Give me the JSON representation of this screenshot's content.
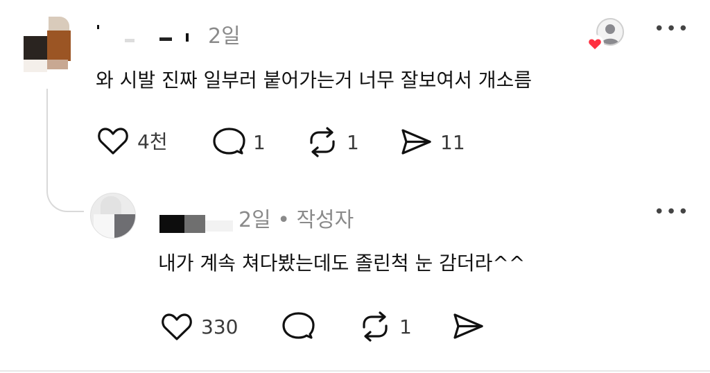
{
  "comment": {
    "time": "2일",
    "body": "와 시발 진짜 일부러 붙어가는거 너무 잘보여서 개소름",
    "actions": {
      "like_count": "4천",
      "reply_count": "1",
      "repost_count": "1",
      "share_count": "11"
    },
    "liked_by_author": true,
    "heart_color": "#ff3040"
  },
  "reply": {
    "time": "2일 • 작성자",
    "body": "내가 계속 쳐다봤는데도 졸린척 눈 감더라^^",
    "actions": {
      "like_count": "330",
      "repost_count": "1"
    }
  },
  "more_label": "•••"
}
